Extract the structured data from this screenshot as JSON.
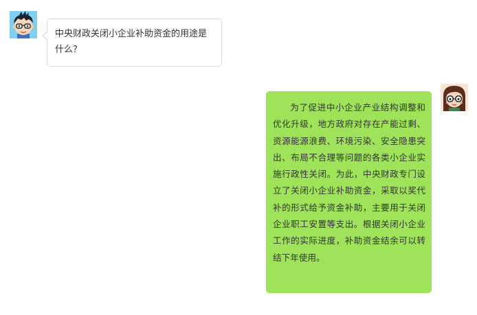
{
  "messages": [
    {
      "sender": "user",
      "text": "中央财政关闭小企业补助资金的用途是什么？"
    },
    {
      "sender": "assistant",
      "text": "为了促进中小企业产业结构调整和优化升级，地方政府对存在产能过剩、资源能源浪费、环境污染、安全隐患突出、布局不合理等问题的各类小企业实施行政性关闭。为此，中央财政专门设立了关闭小企业补助资金，采取以奖代补的形式给予资金补助，主要用于关闭企业职工安置等支出。根据关闭小企业工作的实际进度，补助资金结余可以转结下年使用。"
    }
  ],
  "avatars": {
    "user": "boy-glasses-avatar",
    "assistant": "girl-glasses-avatar"
  },
  "colors": {
    "assistant_bubble": "#9ee35a",
    "user_bubble_border": "#dcdcdc",
    "text": "#333333"
  }
}
